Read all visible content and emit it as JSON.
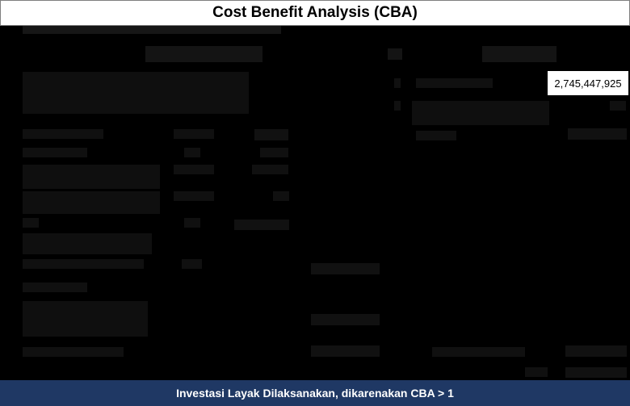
{
  "title": "Cost Benefit Analysis (CBA)",
  "cost_highlight_value": "2,745,447,925",
  "footer": "Investasi Layak Dilaksanakan, dikarenakan CBA > 1"
}
